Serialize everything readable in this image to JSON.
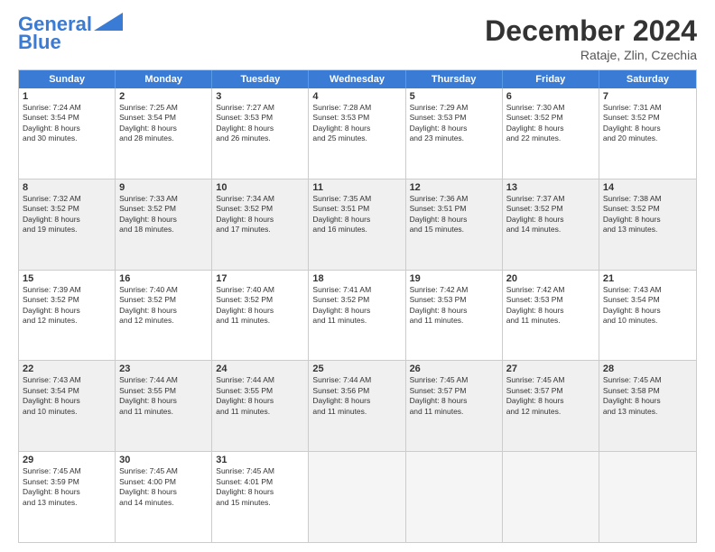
{
  "header": {
    "logo_line1": "General",
    "logo_line2": "Blue",
    "month": "December 2024",
    "location": "Rataje, Zlin, Czechia"
  },
  "days": [
    "Sunday",
    "Monday",
    "Tuesday",
    "Wednesday",
    "Thursday",
    "Friday",
    "Saturday"
  ],
  "weeks": [
    [
      {
        "num": "1",
        "lines": [
          "Sunrise: 7:24 AM",
          "Sunset: 3:54 PM",
          "Daylight: 8 hours",
          "and 30 minutes."
        ]
      },
      {
        "num": "2",
        "lines": [
          "Sunrise: 7:25 AM",
          "Sunset: 3:54 PM",
          "Daylight: 8 hours",
          "and 28 minutes."
        ]
      },
      {
        "num": "3",
        "lines": [
          "Sunrise: 7:27 AM",
          "Sunset: 3:53 PM",
          "Daylight: 8 hours",
          "and 26 minutes."
        ]
      },
      {
        "num": "4",
        "lines": [
          "Sunrise: 7:28 AM",
          "Sunset: 3:53 PM",
          "Daylight: 8 hours",
          "and 25 minutes."
        ]
      },
      {
        "num": "5",
        "lines": [
          "Sunrise: 7:29 AM",
          "Sunset: 3:53 PM",
          "Daylight: 8 hours",
          "and 23 minutes."
        ]
      },
      {
        "num": "6",
        "lines": [
          "Sunrise: 7:30 AM",
          "Sunset: 3:52 PM",
          "Daylight: 8 hours",
          "and 22 minutes."
        ]
      },
      {
        "num": "7",
        "lines": [
          "Sunrise: 7:31 AM",
          "Sunset: 3:52 PM",
          "Daylight: 8 hours",
          "and 20 minutes."
        ]
      }
    ],
    [
      {
        "num": "8",
        "lines": [
          "Sunrise: 7:32 AM",
          "Sunset: 3:52 PM",
          "Daylight: 8 hours",
          "and 19 minutes."
        ]
      },
      {
        "num": "9",
        "lines": [
          "Sunrise: 7:33 AM",
          "Sunset: 3:52 PM",
          "Daylight: 8 hours",
          "and 18 minutes."
        ]
      },
      {
        "num": "10",
        "lines": [
          "Sunrise: 7:34 AM",
          "Sunset: 3:52 PM",
          "Daylight: 8 hours",
          "and 17 minutes."
        ]
      },
      {
        "num": "11",
        "lines": [
          "Sunrise: 7:35 AM",
          "Sunset: 3:51 PM",
          "Daylight: 8 hours",
          "and 16 minutes."
        ]
      },
      {
        "num": "12",
        "lines": [
          "Sunrise: 7:36 AM",
          "Sunset: 3:51 PM",
          "Daylight: 8 hours",
          "and 15 minutes."
        ]
      },
      {
        "num": "13",
        "lines": [
          "Sunrise: 7:37 AM",
          "Sunset: 3:52 PM",
          "Daylight: 8 hours",
          "and 14 minutes."
        ]
      },
      {
        "num": "14",
        "lines": [
          "Sunrise: 7:38 AM",
          "Sunset: 3:52 PM",
          "Daylight: 8 hours",
          "and 13 minutes."
        ]
      }
    ],
    [
      {
        "num": "15",
        "lines": [
          "Sunrise: 7:39 AM",
          "Sunset: 3:52 PM",
          "Daylight: 8 hours",
          "and 12 minutes."
        ]
      },
      {
        "num": "16",
        "lines": [
          "Sunrise: 7:40 AM",
          "Sunset: 3:52 PM",
          "Daylight: 8 hours",
          "and 12 minutes."
        ]
      },
      {
        "num": "17",
        "lines": [
          "Sunrise: 7:40 AM",
          "Sunset: 3:52 PM",
          "Daylight: 8 hours",
          "and 11 minutes."
        ]
      },
      {
        "num": "18",
        "lines": [
          "Sunrise: 7:41 AM",
          "Sunset: 3:52 PM",
          "Daylight: 8 hours",
          "and 11 minutes."
        ]
      },
      {
        "num": "19",
        "lines": [
          "Sunrise: 7:42 AM",
          "Sunset: 3:53 PM",
          "Daylight: 8 hours",
          "and 11 minutes."
        ]
      },
      {
        "num": "20",
        "lines": [
          "Sunrise: 7:42 AM",
          "Sunset: 3:53 PM",
          "Daylight: 8 hours",
          "and 11 minutes."
        ]
      },
      {
        "num": "21",
        "lines": [
          "Sunrise: 7:43 AM",
          "Sunset: 3:54 PM",
          "Daylight: 8 hours",
          "and 10 minutes."
        ]
      }
    ],
    [
      {
        "num": "22",
        "lines": [
          "Sunrise: 7:43 AM",
          "Sunset: 3:54 PM",
          "Daylight: 8 hours",
          "and 10 minutes."
        ]
      },
      {
        "num": "23",
        "lines": [
          "Sunrise: 7:44 AM",
          "Sunset: 3:55 PM",
          "Daylight: 8 hours",
          "and 11 minutes."
        ]
      },
      {
        "num": "24",
        "lines": [
          "Sunrise: 7:44 AM",
          "Sunset: 3:55 PM",
          "Daylight: 8 hours",
          "and 11 minutes."
        ]
      },
      {
        "num": "25",
        "lines": [
          "Sunrise: 7:44 AM",
          "Sunset: 3:56 PM",
          "Daylight: 8 hours",
          "and 11 minutes."
        ]
      },
      {
        "num": "26",
        "lines": [
          "Sunrise: 7:45 AM",
          "Sunset: 3:57 PM",
          "Daylight: 8 hours",
          "and 11 minutes."
        ]
      },
      {
        "num": "27",
        "lines": [
          "Sunrise: 7:45 AM",
          "Sunset: 3:57 PM",
          "Daylight: 8 hours",
          "and 12 minutes."
        ]
      },
      {
        "num": "28",
        "lines": [
          "Sunrise: 7:45 AM",
          "Sunset: 3:58 PM",
          "Daylight: 8 hours",
          "and 13 minutes."
        ]
      }
    ],
    [
      {
        "num": "29",
        "lines": [
          "Sunrise: 7:45 AM",
          "Sunset: 3:59 PM",
          "Daylight: 8 hours",
          "and 13 minutes."
        ]
      },
      {
        "num": "30",
        "lines": [
          "Sunrise: 7:45 AM",
          "Sunset: 4:00 PM",
          "Daylight: 8 hours",
          "and 14 minutes."
        ]
      },
      {
        "num": "31",
        "lines": [
          "Sunrise: 7:45 AM",
          "Sunset: 4:01 PM",
          "Daylight: 8 hours",
          "and 15 minutes."
        ]
      },
      {
        "num": "",
        "lines": []
      },
      {
        "num": "",
        "lines": []
      },
      {
        "num": "",
        "lines": []
      },
      {
        "num": "",
        "lines": []
      }
    ]
  ]
}
